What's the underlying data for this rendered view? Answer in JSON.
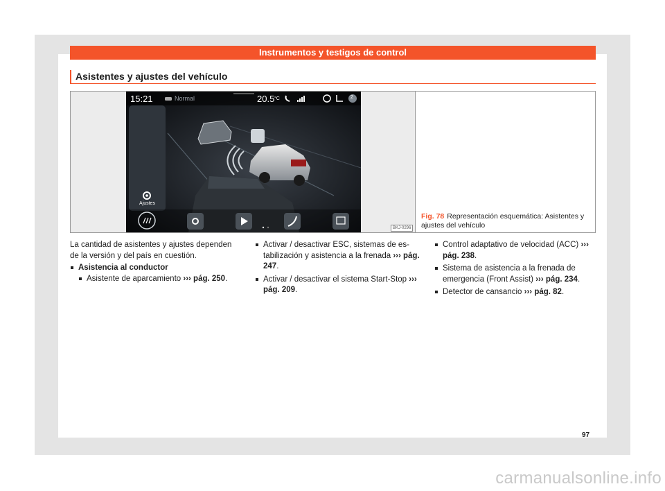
{
  "header": {
    "chapter_title": "Instrumentos y testigos de control"
  },
  "section": {
    "title": "Asistentes y ajustes del vehículo"
  },
  "figure": {
    "screen": {
      "time": "15:21",
      "mode": "Normal",
      "temperature": "20.5",
      "temp_unit": "°C",
      "badge_count": "2",
      "sidebar_label": "Ajustes"
    },
    "code": "BKJ-0296",
    "label": "Fig. 78",
    "caption": "Representación esquemática: Asistentes y ajustes del vehículo"
  },
  "body": {
    "intro": "La cantidad de asistentes y ajustes depen­den de la versión y del país en cuestión.",
    "group_heading": "Asistencia al conductor",
    "items": [
      {
        "text": "Asistente de aparcamiento",
        "ref": "››› pág. 250",
        "end": "."
      },
      {
        "text": "Activar / desactivar ESC, sistemas de es­tabilización y asistencia a la frenada",
        "ref": "››› pág. 247",
        "end": "."
      },
      {
        "text": "Activar / desactivar el sistema Start-Stop",
        "ref": "››› pág. 209",
        "end": "."
      },
      {
        "text": "Control adaptativo de velocidad (ACC)",
        "ref": "››› pág. 238",
        "end": "."
      },
      {
        "text": "Sistema de asistencia a la frenada de emergencia (Front Assist)",
        "ref": "››› pág. 234",
        "end": "."
      },
      {
        "text": "Detector de cansancio",
        "ref": "››› pág. 82",
        "end": "."
      }
    ]
  },
  "page_number": "97",
  "watermark": "carmanualsonline.info",
  "colors": {
    "accent": "#f4542a"
  },
  "icons": [
    "car-icon",
    "phone-icon",
    "signal-icon",
    "globe-icon",
    "seat-icon",
    "parking-sensor-icon",
    "settings-icon",
    "play-icon",
    "grid-icon",
    "lines-icon"
  ]
}
